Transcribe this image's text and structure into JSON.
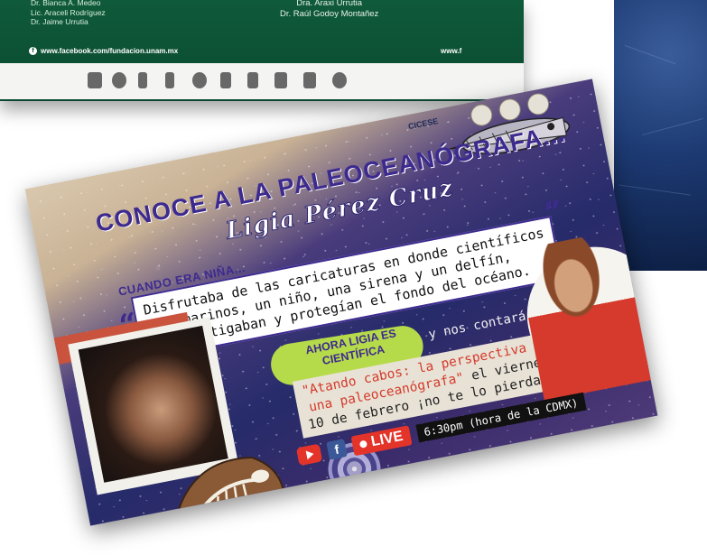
{
  "background_poster": {
    "left_names": [
      "Dr. Bianca A. Medeo",
      "Lic. Araceli Rodríguez",
      "Dr. Jaime Urrutia"
    ],
    "mid_names": [
      "Dra. Araxi Urrutia",
      "Dr. Raúl Godoy Montañez"
    ],
    "facebook": "www.facebook.com/fundacion.unam.mx",
    "web": "www.f"
  },
  "card": {
    "title_line1": "CONOCE A LA PALEOCEANÓGRAFA...",
    "title_line2": "Ligia Pérez Cruz",
    "logo_cicese": "CICESE",
    "child_label": "CUANDO ERA NIÑA...",
    "child_text": "Disfrutaba de las caricaturas en donde científicos marinos, un niño, una sirena y un delfín, investigaban y protegían el fondo del océano.",
    "now_badge": "AHORA LIGIA ES CIENTÍFICA",
    "now_tail": "y nos contará sobre",
    "talk_red": "\"Atando cabos: la perspectiva de una paleoceanógrafa\"",
    "talk_rest": " el viernes 10 de febrero ¡no te lo pierdas!",
    "live_label": "LIVE",
    "fb_label": "f",
    "time": "6:30pm (hora de la CDMX)"
  },
  "colors": {
    "title_purple": "#3d2a8f",
    "accent_red": "#d43a2a",
    "badge_green": "#b6db4a",
    "poster_green": "#0c4f33"
  }
}
